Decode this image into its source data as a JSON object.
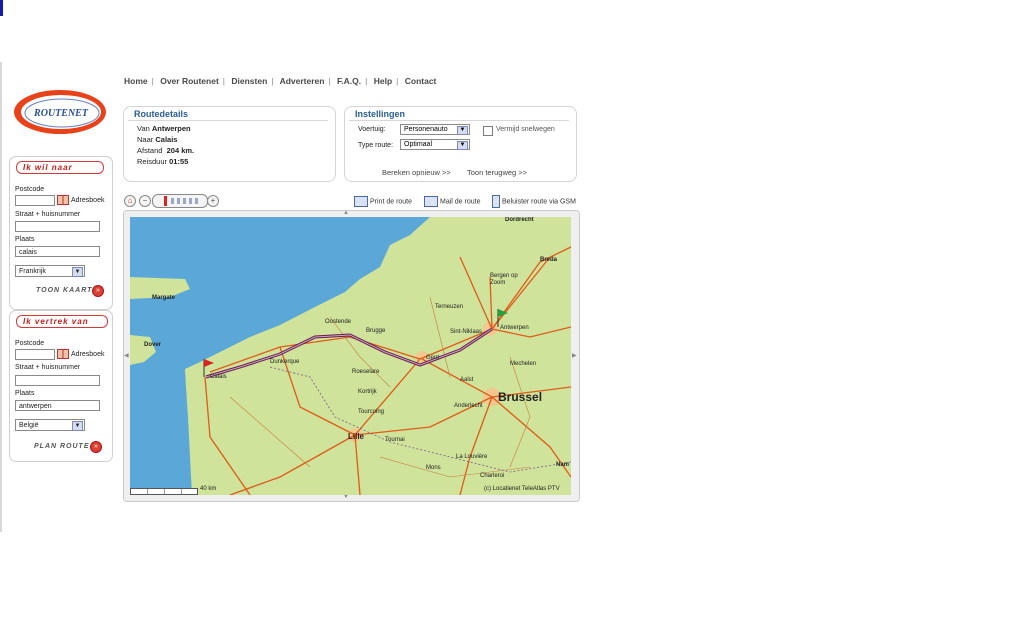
{
  "nav": [
    "Home",
    "Over Routenet",
    "Diensten",
    "Adverteren",
    "F.A.Q.",
    "Help",
    "Contact"
  ],
  "logo_text": "ROUTENET",
  "to_box": {
    "title": "Ik wil naar",
    "postcode_label": "Postcode",
    "adresboek_label": "Adresboek",
    "street_label": "Straat + huisnummer",
    "place_label": "Plaats",
    "place_value": "calais",
    "country_value": "Frankrijk",
    "action_label": "Toon kaart"
  },
  "from_box": {
    "title": "Ik vertrek van",
    "postcode_label": "Postcode",
    "adresboek_label": "Adresboek",
    "street_label": "Straat + huisnummer",
    "place_label": "Plaats",
    "place_value": "antwerpen",
    "country_value": "België",
    "action_label": "Plan route"
  },
  "routedetails": {
    "title": "Routedetails",
    "from_label": "Van",
    "from_value": "Antwerpen",
    "to_label": "Naar",
    "to_value": "Calais",
    "distance_label": "Afstand",
    "distance_value": "204 km.",
    "duration_label": "Reisduur",
    "duration_value": "01:55"
  },
  "settings": {
    "title": "Instellingen",
    "vehicle_label": "Voertuig:",
    "vehicle_value": "Personenauto",
    "avoid_label": "Vermijd snelwegen",
    "routetype_label": "Type route:",
    "routetype_value": "Optimaal",
    "recalc_link": "Bereken opnieuw >>",
    "return_link": "Toon terugweg >>"
  },
  "map_tools": {
    "print": "Print de route",
    "mail": "Mail de route",
    "listen": "Beluister route via GSM"
  },
  "map": {
    "scale_text": "40 km",
    "copyright": "(c) Locatienet TeleAtlas PTV",
    "labels": {
      "dordrecht": "Dordrecht",
      "breda": "Breda",
      "bergen": "Bergen op Zoom",
      "margate": "Margate",
      "oostende": "Oostende",
      "brugge": "Brugge",
      "terneuzen": "Terneuzen",
      "sint_niklaas": "Sint-Niklaas",
      "antwerpen": "Antwerpen",
      "dover": "Dover",
      "duinkerque": "Dunkerque",
      "gent": "Gent",
      "mechelen": "Mechelen",
      "calais": "Calais",
      "roeselare": "Roeselare",
      "aalst": "Aalst",
      "kortrijk": "Kortrijk",
      "brussel": "Brussel",
      "anderlecht": "Anderlecht",
      "tourcoing": "Tourcoing",
      "lille": "Lille",
      "tournai": "Tournai",
      "la_louviere": "La Louvière",
      "mons": "Mons",
      "namur": "Nam",
      "charleroi": "Charleroi"
    }
  },
  "colors": {
    "sea": "#5ba8d8",
    "land": "#cfe39b",
    "route": "#6a1a4a",
    "road_major": "#e05a1a",
    "panel_title": "#2a5d9a",
    "accent_red": "#c51a1a"
  }
}
